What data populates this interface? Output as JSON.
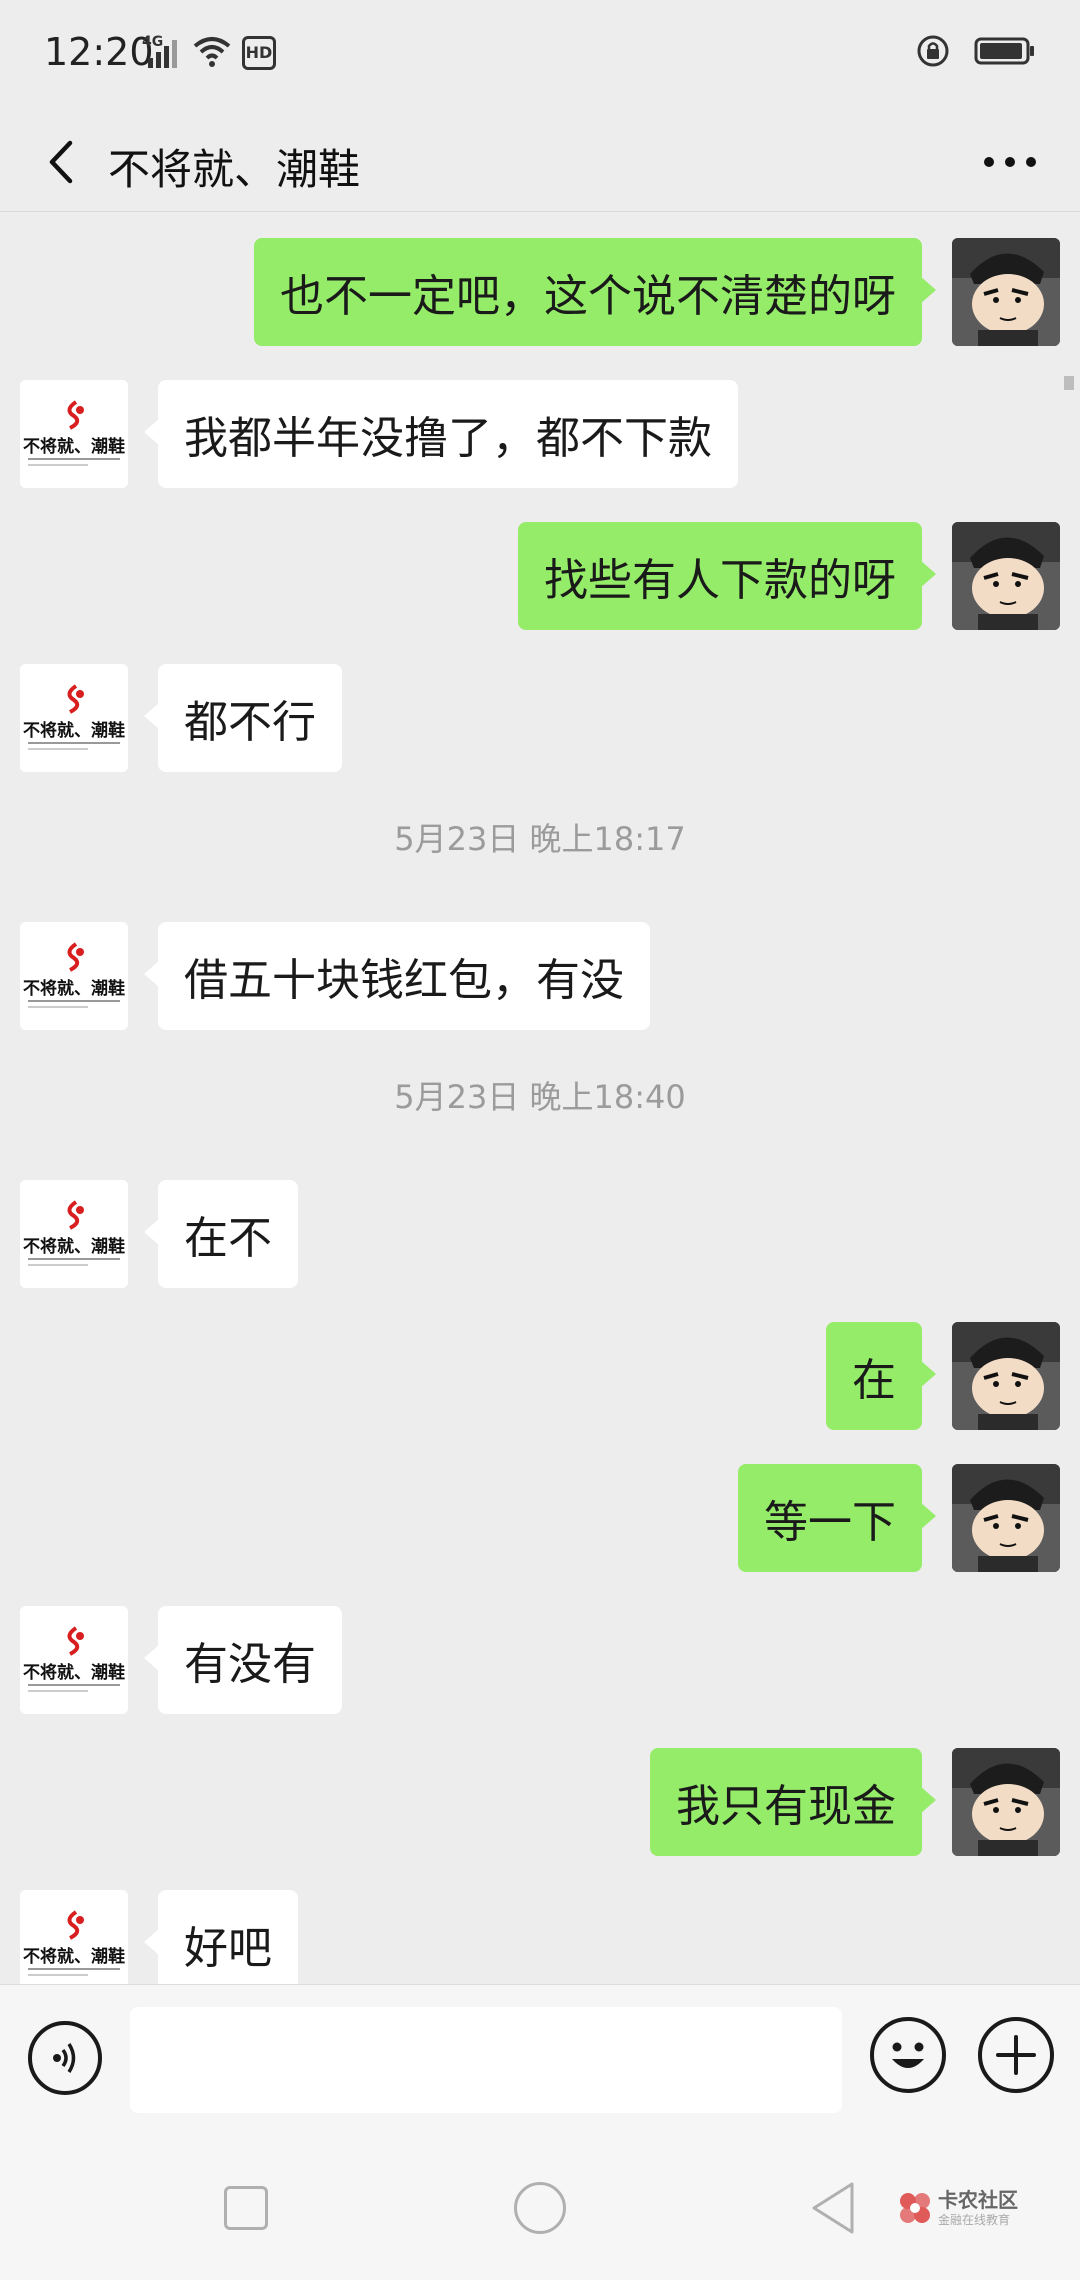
{
  "status_bar": {
    "time": "12:20",
    "network": "4G",
    "hd": "HD"
  },
  "nav": {
    "title": "不将就、潮鞋"
  },
  "contact_avatar_text": "不将就、潮鞋",
  "messages": [
    {
      "side": "right",
      "text": "也不一定吧，这个说不清楚的呀"
    },
    {
      "side": "left",
      "text": "我都半年没撸了，都不下款"
    },
    {
      "side": "right",
      "text": "找些有人下款的呀"
    },
    {
      "side": "left",
      "text": "都不行"
    },
    {
      "type": "time",
      "text": "5月23日 晚上18:17"
    },
    {
      "side": "left",
      "text": "借五十块钱红包，有没"
    },
    {
      "type": "time",
      "text": "5月23日 晚上18:40"
    },
    {
      "side": "left",
      "text": "在不"
    },
    {
      "side": "right",
      "text": "在"
    },
    {
      "side": "right",
      "text": "等一下"
    },
    {
      "side": "left",
      "text": "有没有"
    },
    {
      "side": "right",
      "text": "我只有现金"
    },
    {
      "side": "left",
      "text": "好吧"
    }
  ],
  "input": {
    "value": "",
    "placeholder": ""
  },
  "watermark": {
    "title": "卡农社区",
    "subtitle": "金融在线教育"
  },
  "colors": {
    "background": "#EDEDED",
    "sent_bubble": "#95EC69",
    "received_bubble": "#FFFFFF",
    "timestamp": "#9B9B9B"
  }
}
